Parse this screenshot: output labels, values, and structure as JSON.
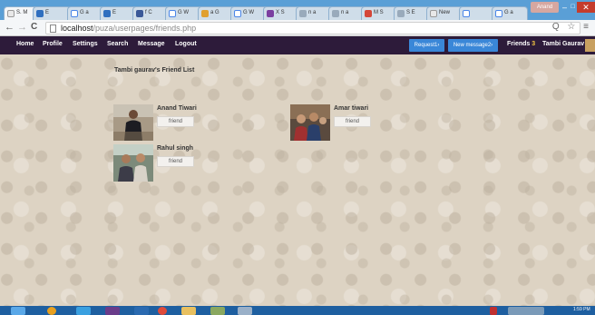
{
  "browser": {
    "tabs": [
      {
        "label": "S. M",
        "active": true
      },
      {
        "label": "E"
      },
      {
        "label": "G a"
      },
      {
        "label": "E"
      },
      {
        "label": "f C"
      },
      {
        "label": "G W"
      },
      {
        "label": "a G"
      },
      {
        "label": "G W"
      },
      {
        "label": "X S"
      },
      {
        "label": "n a"
      },
      {
        "label": "n a"
      },
      {
        "label": "M S"
      },
      {
        "label": "S E"
      },
      {
        "label": "New"
      },
      {
        "label": "G 6"
      },
      {
        "label": "G a"
      },
      {
        "label": "E 6"
      },
      {
        "label": "S 6"
      }
    ],
    "profile_button": "Anand",
    "window_controls": {
      "minimize": "–",
      "maximize": "□",
      "close": "✕"
    },
    "nav": {
      "back": "←",
      "forward": "→",
      "reload": "C"
    },
    "url": {
      "host": "localhost",
      "path": "/puza/userpages/friends.php"
    },
    "right_icons": "Q ☆ ≡"
  },
  "site_nav": {
    "links": [
      "Home",
      "Profile",
      "Settings",
      "Search",
      "Message",
      "Logout"
    ],
    "request_button": "Request1›",
    "message_button": "New message2›",
    "friends_label": "Friends",
    "friends_count": "3",
    "user_name": "Tambi Gaurav"
  },
  "page": {
    "title": "Tambi gaurav's Friend List",
    "friends": [
      {
        "name": "Anand Tiwari",
        "button": "friend"
      },
      {
        "name": "Amar tiwari",
        "button": "friend"
      },
      {
        "name": "Rahul singh",
        "button": "friend"
      }
    ]
  },
  "taskbar": {
    "clock": "1:59 PM"
  },
  "colors": {
    "nav_bg": "#2d1b3a",
    "button_blue": "#3a87d8",
    "page_bg": "#ddd3c3",
    "taskbar": "#1e5fa0"
  }
}
